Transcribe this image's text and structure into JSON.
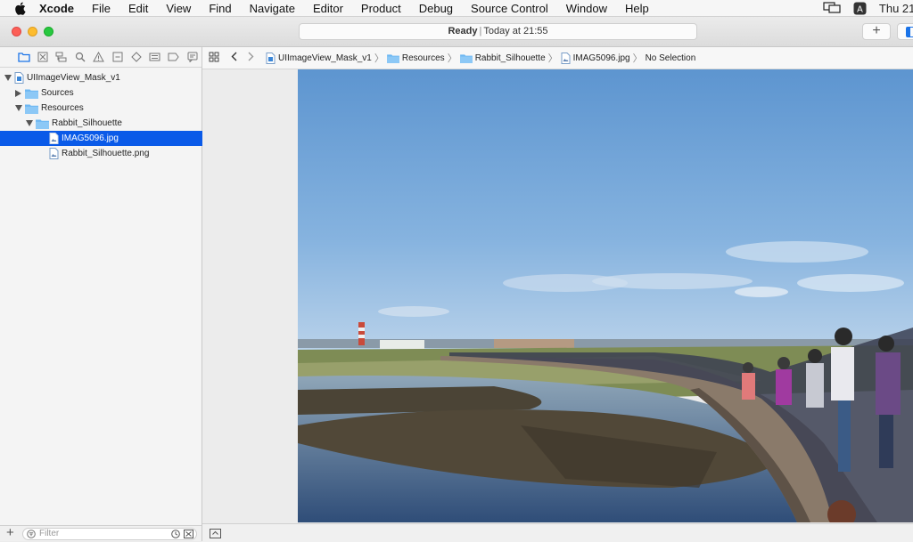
{
  "menubar": {
    "app": "Xcode",
    "items": [
      "File",
      "Edit",
      "View",
      "Find",
      "Navigate",
      "Editor",
      "Product",
      "Debug",
      "Source Control",
      "Window",
      "Help"
    ],
    "clock": "Thu 21:",
    "input_source": "A"
  },
  "toolbar": {
    "status_state": "Ready",
    "status_time": "Today at 21:55",
    "add_label": "+"
  },
  "navigator": {
    "tree": {
      "project": "UIImageView_Mask_v1",
      "sources": "Sources",
      "resources": "Resources",
      "rabbit_folder": "Rabbit_Silhouette",
      "file_jpg": "IMAG5096.jpg",
      "file_png": "Rabbit_Silhouette.png"
    },
    "filter_placeholder": "Filter"
  },
  "jumpbar": {
    "project": "UIImageView_Mask_v1",
    "resources": "Resources",
    "folder": "Rabbit_Silhouette",
    "file": "IMAG5096.jpg",
    "selection": "No Selection"
  },
  "colors": {
    "selection": "#0a5ae8",
    "folder_blue": "#6db7f2",
    "sky": "#6a9ed4"
  }
}
